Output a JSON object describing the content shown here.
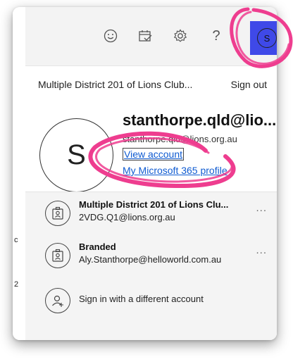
{
  "header": {
    "icons": [
      "smiley-icon",
      "calendar-check-icon",
      "gear-icon",
      "help-icon"
    ],
    "avatar_letter": "S",
    "avatar_color": "#3f49e8"
  },
  "panel": {
    "org_name": "Multiple District 201 of Lions Club...",
    "sign_out": "Sign out",
    "avatar_letter": "S",
    "display_name": "stanthorpe.qld@lio...",
    "email": "stanthorpe.qld@lions.org.au",
    "view_account": "View account",
    "m365_profile": "My Microsoft 365 profile"
  },
  "accounts": [
    {
      "name": "Multiple District 201 of Lions Clu...",
      "email": "2VDG.Q1@lions.org.au",
      "more": "..."
    },
    {
      "name": "Branded",
      "email": "Aly.Stanthorpe@helloworld.com.au",
      "more": "..."
    }
  ],
  "signin_other": "Sign in with a different account",
  "page_fragments": [
    "c",
    "2"
  ],
  "highlight_color": "#ee3d8f"
}
